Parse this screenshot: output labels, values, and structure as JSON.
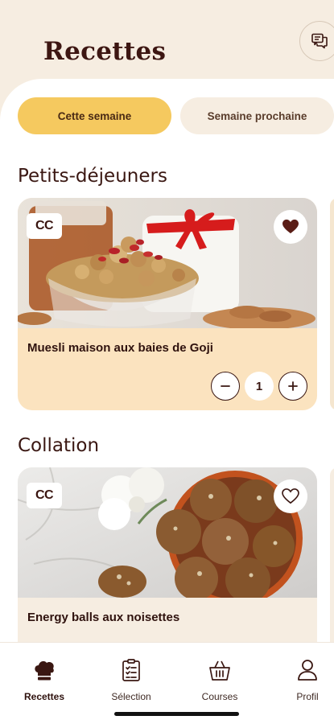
{
  "header": {
    "title": "Recettes"
  },
  "tabs": [
    {
      "label": "Cette semaine",
      "active": true
    },
    {
      "label": "Semaine prochaine",
      "active": false
    }
  ],
  "sections": [
    {
      "title": "Petits-déjeuners",
      "recipe": {
        "badge": "CC",
        "name": "Muesli maison aux baies de Goji",
        "favorite": true,
        "quantity": "1"
      }
    },
    {
      "title": "Collation",
      "recipe": {
        "badge": "CC",
        "name": "Energy balls aux noisettes",
        "favorite": false
      }
    }
  ],
  "bottom_nav": [
    {
      "label": "Recettes",
      "icon": "chef-hat-icon",
      "active": true
    },
    {
      "label": "Sélection",
      "icon": "clipboard-icon",
      "active": false
    },
    {
      "label": "Courses",
      "icon": "basket-icon",
      "active": false
    },
    {
      "label": "Profil",
      "icon": "user-icon",
      "active": false
    }
  ],
  "colors": {
    "accent": "#f5c95f",
    "cream": "#f6ede1",
    "card_peach": "#fbe3bf",
    "text_dark": "#3a1712"
  }
}
